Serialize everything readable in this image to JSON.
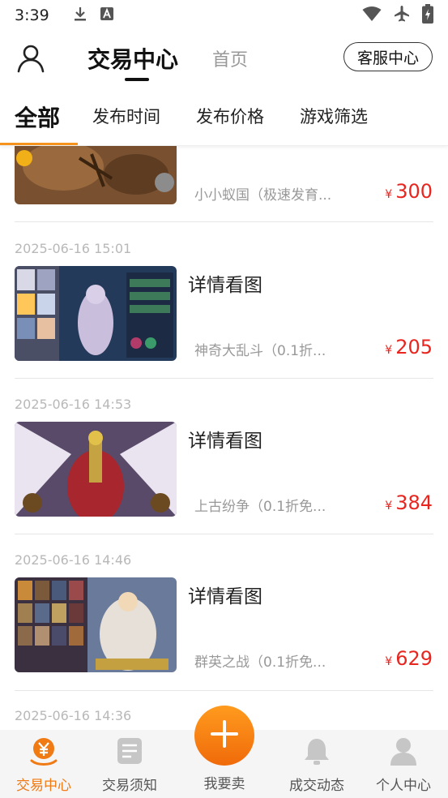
{
  "status_bar": {
    "time": "3:39",
    "icons_left": [
      "download-icon",
      "a-notification-icon"
    ],
    "icons_right": [
      "wifi-icon",
      "airplane-icon",
      "battery-icon"
    ]
  },
  "header": {
    "title_active": "交易中心",
    "title_home": "首页",
    "service_button": "客服中心",
    "user_icon": "user-icon"
  },
  "filters": {
    "tabs": [
      "全部",
      "发布时间",
      "发布价格",
      "游戏筛选"
    ],
    "active_index": 0,
    "accent_color": "#f5931d"
  },
  "listings": [
    {
      "date": "",
      "title": "",
      "game": "小小蚁国（极速发育...",
      "currency": "¥",
      "price": "300"
    },
    {
      "date": "2025-06-16 15:01",
      "title": "详情看图",
      "game": "神奇大乱斗（0.1折...",
      "currency": "¥",
      "price": "205"
    },
    {
      "date": "2025-06-16 14:53",
      "title": "详情看图",
      "game": "上古纷争（0.1折免...",
      "currency": "¥",
      "price": "384"
    },
    {
      "date": "2025-06-16 14:46",
      "title": "详情看图",
      "game": "群英之战（0.1折免...",
      "currency": "¥",
      "price": "629"
    },
    {
      "date": "2025-06-16 14:36",
      "title": "",
      "game": "",
      "currency": "",
      "price": ""
    }
  ],
  "price_color": "#e8261f",
  "tabbar": {
    "items": [
      {
        "label": "交易中心",
        "icon": "yen-coin-icon",
        "active": true
      },
      {
        "label": "交易须知",
        "icon": "document-icon",
        "active": false
      },
      {
        "label": "我要卖",
        "icon": "plus-icon",
        "active": false
      },
      {
        "label": "成交动态",
        "icon": "bell-icon",
        "active": false
      },
      {
        "label": "个人中心",
        "icon": "person-icon",
        "active": false
      }
    ],
    "active_color": "#f07a14"
  }
}
